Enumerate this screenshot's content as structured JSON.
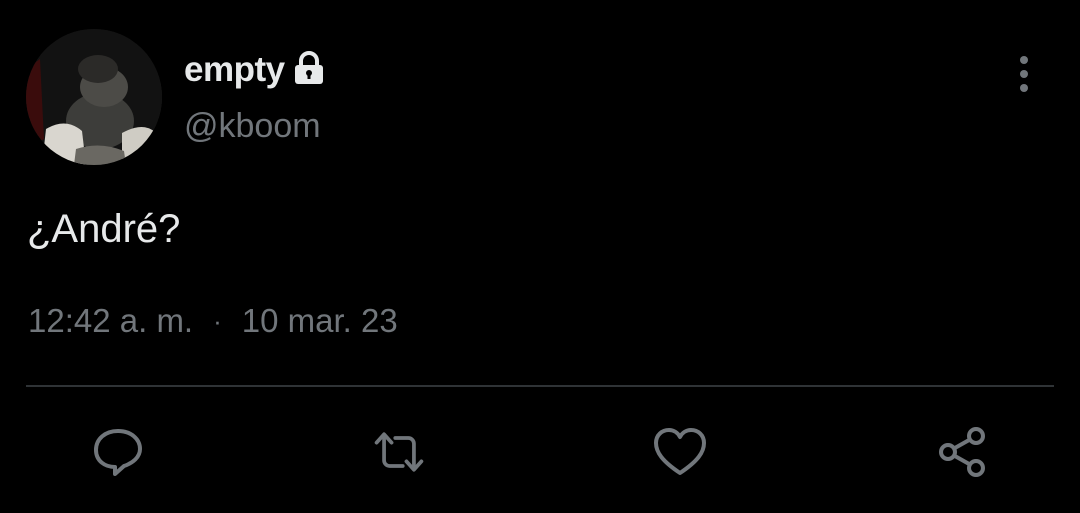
{
  "tweet": {
    "author": {
      "display_name": "empty",
      "handle": "@kboom",
      "avatar_icon": "avatar-photo",
      "protected_icon": "lock-icon"
    },
    "text": "¿André?",
    "time": "12:42 a. m.",
    "separator": "·",
    "date": "10 mar. 23"
  },
  "actions": {
    "reply_icon": "reply-icon",
    "retweet_icon": "retweet-icon",
    "like_icon": "heart-icon",
    "share_icon": "share-icon",
    "more_icon": "more-vertical-icon"
  },
  "colors": {
    "background": "#000000",
    "primary_text": "#e7e9ea",
    "secondary_text": "#71767b",
    "divider": "#2f3336"
  }
}
